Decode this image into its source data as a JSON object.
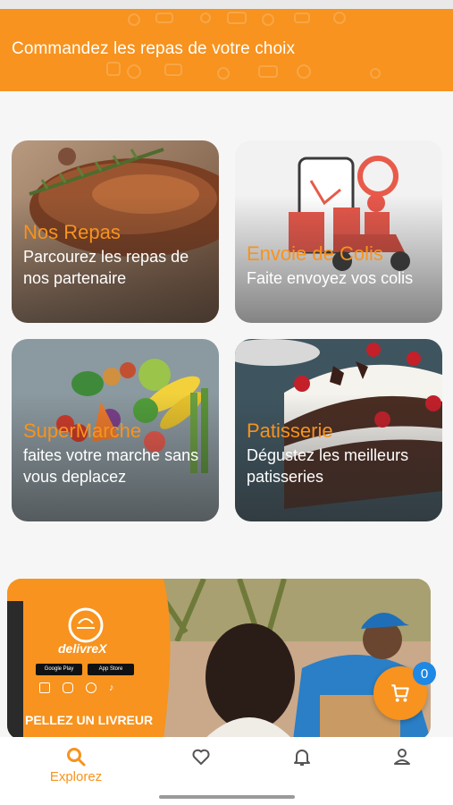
{
  "header": {
    "title": "Commandez les repas de votre choix"
  },
  "categories": [
    {
      "title": "Nos Repas",
      "description": "Parcourez les repas de nos partenaire",
      "image_icon": "roast-meat-image"
    },
    {
      "title": "Envoie de Colis",
      "description": "Faite envoyez vos colis",
      "image_icon": "delivery-scooter-image"
    },
    {
      "title": "SuperMarche",
      "description": "faites votre marche sans vous deplacez",
      "image_icon": "vegetables-image"
    },
    {
      "title": "Patisserie",
      "description": "Dégustez les meilleurs patisseries",
      "image_icon": "cake-image"
    }
  ],
  "banner": {
    "brand": "delivreX",
    "store_badges": [
      "Google Play",
      "App Store"
    ],
    "social_icons": [
      "facebook-icon",
      "instagram-icon",
      "whatsapp-icon",
      "tiktok-icon"
    ],
    "cta": "PELLEZ UN LIVREUR"
  },
  "cart": {
    "count": "0"
  },
  "bottom_nav": {
    "items": [
      {
        "label": "Explorez",
        "icon": "search-icon",
        "active": true
      },
      {
        "label": "",
        "icon": "heart-icon",
        "active": false
      },
      {
        "label": "",
        "icon": "bell-icon",
        "active": false
      },
      {
        "label": "",
        "icon": "user-icon",
        "active": false
      }
    ]
  },
  "colors": {
    "accent": "#f7931e",
    "badge": "#1e88e5"
  }
}
